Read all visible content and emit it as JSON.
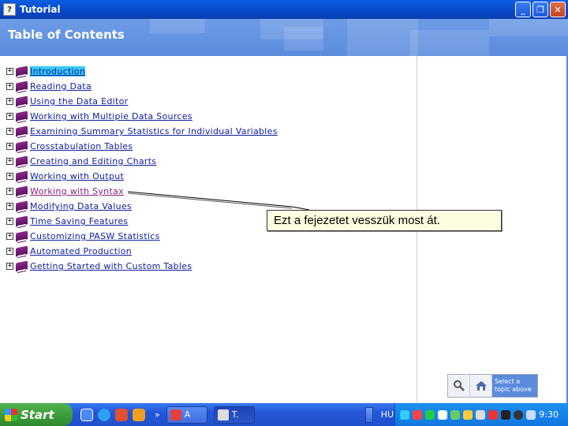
{
  "window": {
    "title": "Tutorial"
  },
  "header": {
    "title": "Table of Contents"
  },
  "toc": [
    {
      "label": "Introduction",
      "expander": "+",
      "state": "selected"
    },
    {
      "label": "Reading Data",
      "expander": "+",
      "state": "normal"
    },
    {
      "label": "Using the Data Editor",
      "expander": "+",
      "state": "normal"
    },
    {
      "label": "Working with Multiple Data Sources",
      "expander": "+",
      "state": "normal"
    },
    {
      "label": "Examining Summary Statistics for Individual Variables",
      "expander": "+",
      "state": "normal"
    },
    {
      "label": "Crosstabulation Tables",
      "expander": "+",
      "state": "normal"
    },
    {
      "label": "Creating and Editing Charts",
      "expander": "+",
      "state": "normal"
    },
    {
      "label": "Working with Output",
      "expander": "+",
      "state": "normal"
    },
    {
      "label": "Working with Syntax",
      "expander": "+",
      "state": "visited"
    },
    {
      "label": "Modifying Data Values",
      "expander": "+",
      "state": "normal"
    },
    {
      "label": "Time Saving Features",
      "expander": "+",
      "state": "normal"
    },
    {
      "label": "Customizing PASW Statistics",
      "expander": "+",
      "state": "normal"
    },
    {
      "label": "Automated Production",
      "expander": "+",
      "state": "normal"
    },
    {
      "label": "Getting Started with Custom Tables",
      "expander": "+",
      "state": "normal"
    }
  ],
  "callout": {
    "text": "Ezt a fejezetet vesszük most át."
  },
  "toolbox": {
    "hint": "Select a topic above",
    "search_icon": "magnifier-icon",
    "home_icon": "home-icon"
  },
  "taskbar": {
    "start_label": "Start",
    "chevron": "»",
    "tasks": [
      {
        "label": "A"
      },
      {
        "label": "T."
      }
    ],
    "language": "HU",
    "clock": "9:30"
  },
  "colors": {
    "link": "#1020a0",
    "visited": "#8a2080",
    "selected_bg": "#38c8f8",
    "header_bg": "#5b8bdc"
  }
}
